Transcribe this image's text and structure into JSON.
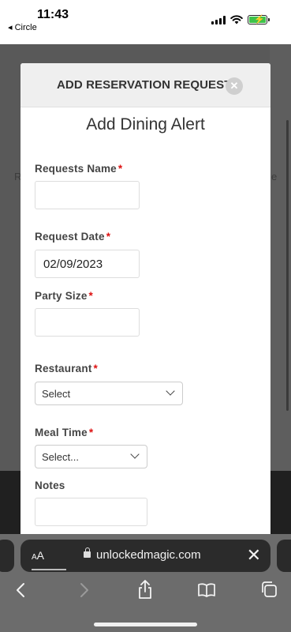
{
  "status_bar": {
    "time": "11:43",
    "back_app": "◂ Circle"
  },
  "modal": {
    "header_title": "ADD RESERVATION REQUEST",
    "close_glyph": "✕",
    "subtitle": "Add Dining Alert",
    "required_marker": "*",
    "fields": {
      "requests_name": {
        "label": "Requests Name",
        "value": ""
      },
      "request_date": {
        "label": "Request Date",
        "value": "02/09/2023"
      },
      "party_size": {
        "label": "Party Size",
        "value": ""
      },
      "restaurant": {
        "label": "Restaurant",
        "selected": "Select"
      },
      "meal_time": {
        "label": "Meal Time",
        "selected": "Select..."
      },
      "notes": {
        "label": "Notes",
        "value": ""
      }
    }
  },
  "browser": {
    "aa_label_small": "A",
    "aa_label_large": "A",
    "url": "unlockedmagic.com",
    "close_glyph": "✕"
  },
  "backdrop": {
    "left_letter": "R",
    "right_letter": "e"
  },
  "colors": {
    "required": "#dd1111",
    "modal_header_bg": "#efefef",
    "address_bar_bg": "#2b2b2b"
  },
  "icons": [
    "back-arrow-icon",
    "forward-arrow-icon",
    "share-icon",
    "bookmarks-icon",
    "tabs-icon",
    "lock-icon",
    "wifi-icon",
    "signal-icon",
    "battery-icon"
  ]
}
